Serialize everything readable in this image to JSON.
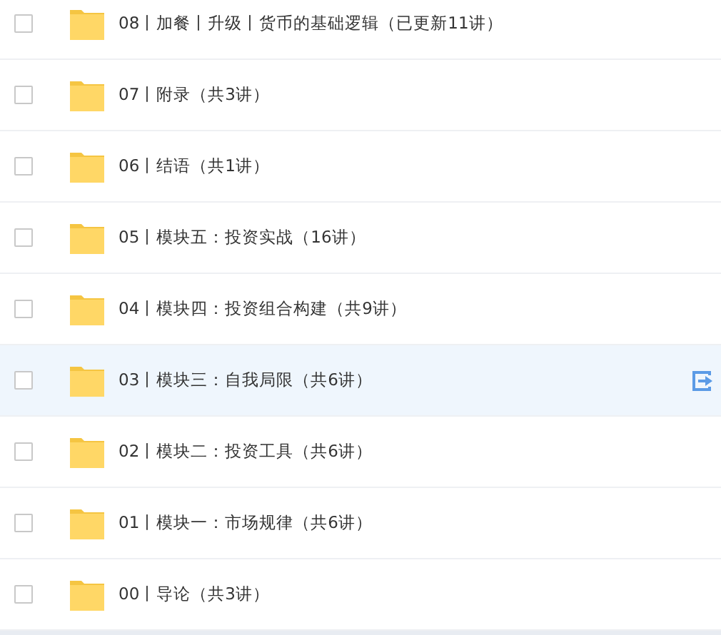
{
  "folders": [
    {
      "name": "08丨加餐丨升级丨货币的基础逻辑（已更新11讲）",
      "checked": false,
      "selected": false
    },
    {
      "name": "07丨附录（共3讲）",
      "checked": false,
      "selected": false
    },
    {
      "name": "06丨结语（共1讲）",
      "checked": false,
      "selected": false
    },
    {
      "name": "05丨模块五：投资实战（16讲）",
      "checked": false,
      "selected": false
    },
    {
      "name": "04丨模块四：投资组合构建（共9讲）",
      "checked": false,
      "selected": false
    },
    {
      "name": "03丨模块三：自我局限（共6讲）",
      "checked": false,
      "selected": true
    },
    {
      "name": "02丨模块二：投资工具（共6讲）",
      "checked": false,
      "selected": false
    },
    {
      "name": "01丨模块一：市场规律（共6讲）",
      "checked": false,
      "selected": false
    },
    {
      "name": "00丨导论（共3讲）",
      "checked": false,
      "selected": false
    }
  ]
}
